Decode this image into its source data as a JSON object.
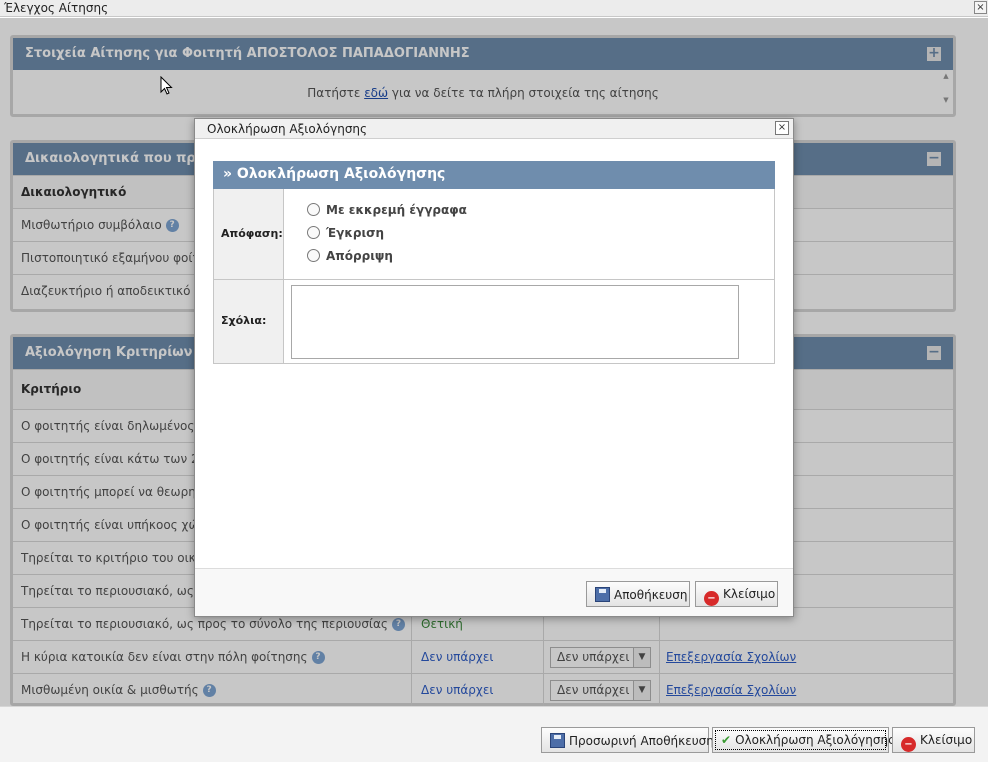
{
  "window": {
    "title": "Έλεγχος Αίτησης",
    "close": "×"
  },
  "panel1": {
    "title": "Στοιχεία Αίτησης για Φοιτητή ΑΠΟΣΤΟΛΟΣ ΠΑΠΑΔΟΓΙΑΝΝΗΣ",
    "toggle": "+",
    "text_before": "Πατήστε",
    "link": "εδώ",
    "text_after": "για να δείτε τα πλήρη στοιχεία της αίτησης"
  },
  "panel2": {
    "title": "Δικαιολογητικά που πρέπει",
    "toggle": "−",
    "header": "Δικαιολογητικό",
    "rows": [
      "Μισθωτήριο συμβόλαιο",
      "Πιστοποιητικό εξαμήνου φοίτησ",
      "Διαζευκτήριο ή αποδεικτικό γονι"
    ]
  },
  "panel3": {
    "title": "Αξιολόγηση Κριτηρίων",
    "toggle": "−",
    "header": "Κριτήριο",
    "rows": [
      {
        "label": "Ο φοιτητής είναι δηλωμένος ως",
        "value": "",
        "select": "",
        "link": ""
      },
      {
        "label": "Ο φοιτητής είναι κάτω των 25 ε",
        "value": "",
        "select": "",
        "link": ""
      },
      {
        "label": "Ο φοιτητής μπορεί να θεωρηθεί",
        "value": "",
        "select": "",
        "link": ""
      },
      {
        "label": "Ο φοιτητής είναι υπήκοος χώρα",
        "value": "",
        "select": "",
        "link": ""
      },
      {
        "label": "Τηρείται το κριτήριο του οικογεν",
        "value": "",
        "select": "",
        "link": ""
      },
      {
        "label": "Τηρείται το περιουσιακό, ως προ",
        "value": "",
        "select": "",
        "link": ""
      },
      {
        "label": "Τηρείται το περιουσιακό, ως προς το σύνολο της περιουσίας",
        "value": "Θετική",
        "select": "",
        "link": ""
      },
      {
        "label": "Η κύρια κατοικία δεν είναι στην πόλη φοίτησης",
        "value": "Δεν υπάρχει",
        "select": "Δεν υπάρχει",
        "link": "Επεξεργασία Σχολίων"
      },
      {
        "label": "Μισθωμένη οικία & μισθωτής",
        "value": "Δεν υπάρχει",
        "select": "Δεν υπάρχει",
        "link": "Επεξεργασία Σχολίων"
      }
    ]
  },
  "footer": {
    "temp_save": "Προσωρινή Αποθήκευση",
    "complete": "Ολοκλήρωση Αξιολόγησης",
    "close": "Κλείσιμο"
  },
  "modal": {
    "title": "Ολοκλήρωση Αξιολόγησης",
    "close": "×",
    "section_title": "» Ολοκλήρωση Αξιολόγησης",
    "decision_label": "Απόφαση:",
    "options": [
      "Με εκκρεμή έγγραφα",
      "Έγκριση",
      "Απόρριψη"
    ],
    "comments_label": "Σχόλια:",
    "comments_value": "",
    "save": "Αποθήκευση",
    "cancel": "Κλείσιμο"
  },
  "icons": {
    "help": "help-icon",
    "save": "floppy-disk-icon",
    "check": "checkmark-icon",
    "close": "no-entry-icon"
  },
  "colors": {
    "panel_header": "#6f8dad",
    "link": "#2f5ec8",
    "positive": "#3c8a3c",
    "danger": "#d72a2a"
  }
}
